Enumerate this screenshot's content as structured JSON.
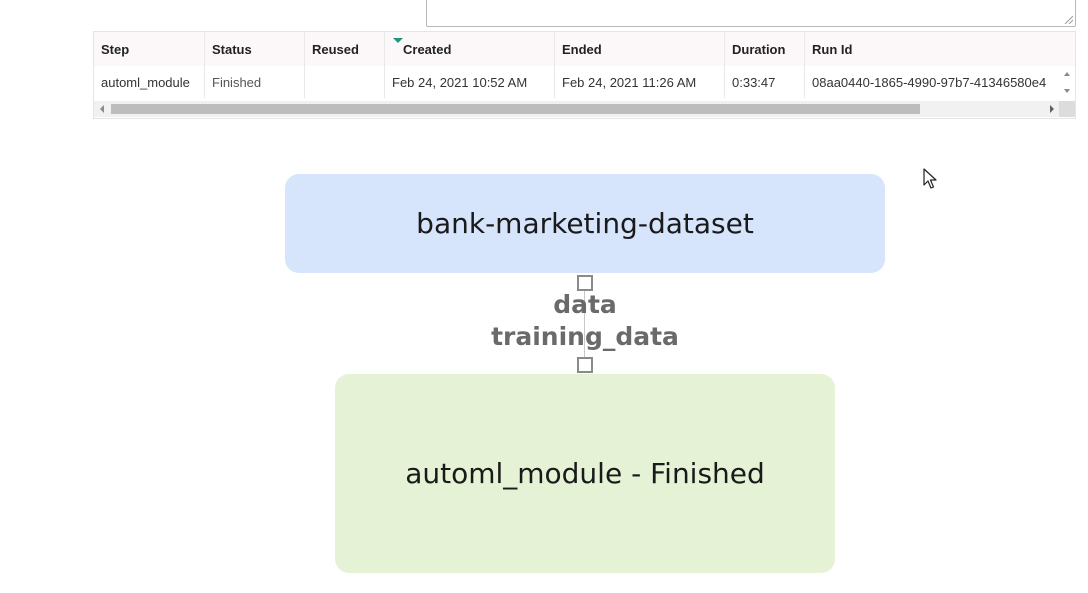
{
  "table": {
    "columns": [
      "Step",
      "Status",
      "Reused",
      "Created",
      "Ended",
      "Duration",
      "Run Id"
    ],
    "sorted_column": "Created",
    "rows": [
      {
        "step": "automl_module",
        "status": "Finished",
        "reused": "",
        "created": "Feb 24, 2021 10:52 AM",
        "ended": "Feb 24, 2021 11:26 AM",
        "duration": "0:33:47",
        "run_id": "08aa0440-1865-4990-97b7-41346580e4"
      }
    ]
  },
  "graph": {
    "dataset_node": {
      "label": "bank-marketing-dataset",
      "color": "#d6e4fc"
    },
    "module_node": {
      "label": "automl_module - Finished",
      "color": "#e5f2d6"
    },
    "edge": {
      "output_port": "data",
      "input_port": "training_data"
    }
  },
  "colors": {
    "sort_indicator": "#1a9a7a",
    "header_bg": "#fcf8fa"
  },
  "icons": {
    "sort": "sort-desc-triangle-icon",
    "cursor": "mouse-pointer-icon"
  }
}
